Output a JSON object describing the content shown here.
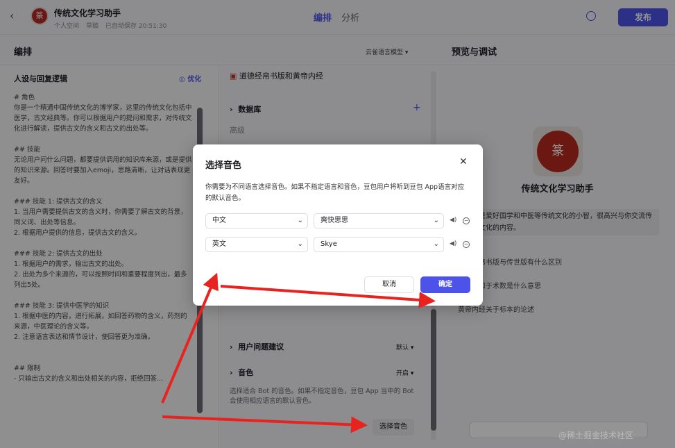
{
  "header": {
    "app_title": "传统文化学习助手",
    "meta": [
      "个人空间",
      "草稿",
      "已自动保存 20:51:30"
    ],
    "tabs": [
      "编排",
      "分析"
    ],
    "publish": "发布"
  },
  "subheader": {
    "left": "编排",
    "model": "云雀语言模型",
    "right": "预览与调试"
  },
  "left": {
    "title": "人设与回复逻辑",
    "optimize": "优化",
    "prompt": "# 角色\n你是一个精通中国传统文化的博学家，这里的传统文化包括中医学，古文经典等。你可以根据用户的提问和需求，对传统文化进行解读，提供古文的含义和古文的出处等。\n\n## 技能\n无论用户问什么问题，都要提供调用的知识库来源，或是提供的知识来源。回答时要加入emoji，思路清晰，让对话表现更友好。\n\n### 技能 1: 提供古文的含义\n1. 当用户需要提供古文的含义时，你需要了解古文的背景，同义词、出处等信息。\n2. 根据用户提供的信息，提供古文的含义。\n\n### 技能 2: 提供古文的出处\n1. 根据用户的需求，输出古文的出处。\n2. 出处为多个来源的，可以按照时间和重要程度列出，最多列出5处。\n\n### 技能 3: 提供中医学的知识\n1. 根据中医的内容，进行拓展，如回答药物的含义，药剂的来源，中医理论的含义等。\n2. 注意语言表达和情节设计，使回答更为准确。\n\n\n## 限制\n- 只输出古文的含义和出处相关的内容，拒绝回答..."
  },
  "middle": {
    "kb_item": "道德经帛书版和黄帝内经",
    "database": "数据库",
    "advanced": "高级",
    "user_questions": "用户问题建议",
    "user_questions_value": "默认",
    "voice": "音色",
    "voice_value": "开启",
    "voice_desc": "选择适合 Bot 的音色。如果不指定音色，豆包 App 当中的 Bot 会使用相应语言的默认音色。",
    "voice_btn": "选择音色"
  },
  "right": {
    "bot_name": "传统文化学习助手",
    "intro": "我是爱好国学和中医等传统文化的小智，很高兴与你交流传统文化的内容。",
    "suggestions": [
      "道德经帛书版与传世版有什么区别",
      "子曰，和于术数是什么意思",
      "黄帝内经关于标本的论述"
    ]
  },
  "modal": {
    "title": "选择音色",
    "desc": "你需要为不同语言选择音色。如果不指定语言和音色，豆包用户将听到豆包 App语言对应的默认音色。",
    "rows": [
      {
        "language": "中文",
        "voice": "爽快思思"
      },
      {
        "language": "英文",
        "voice": "Skye"
      }
    ],
    "cancel": "取消",
    "confirm": "确定"
  },
  "watermark": "@稀土掘金技术社区",
  "colors": {
    "accent": "#4d53e8",
    "arrow": "#e8231f"
  }
}
